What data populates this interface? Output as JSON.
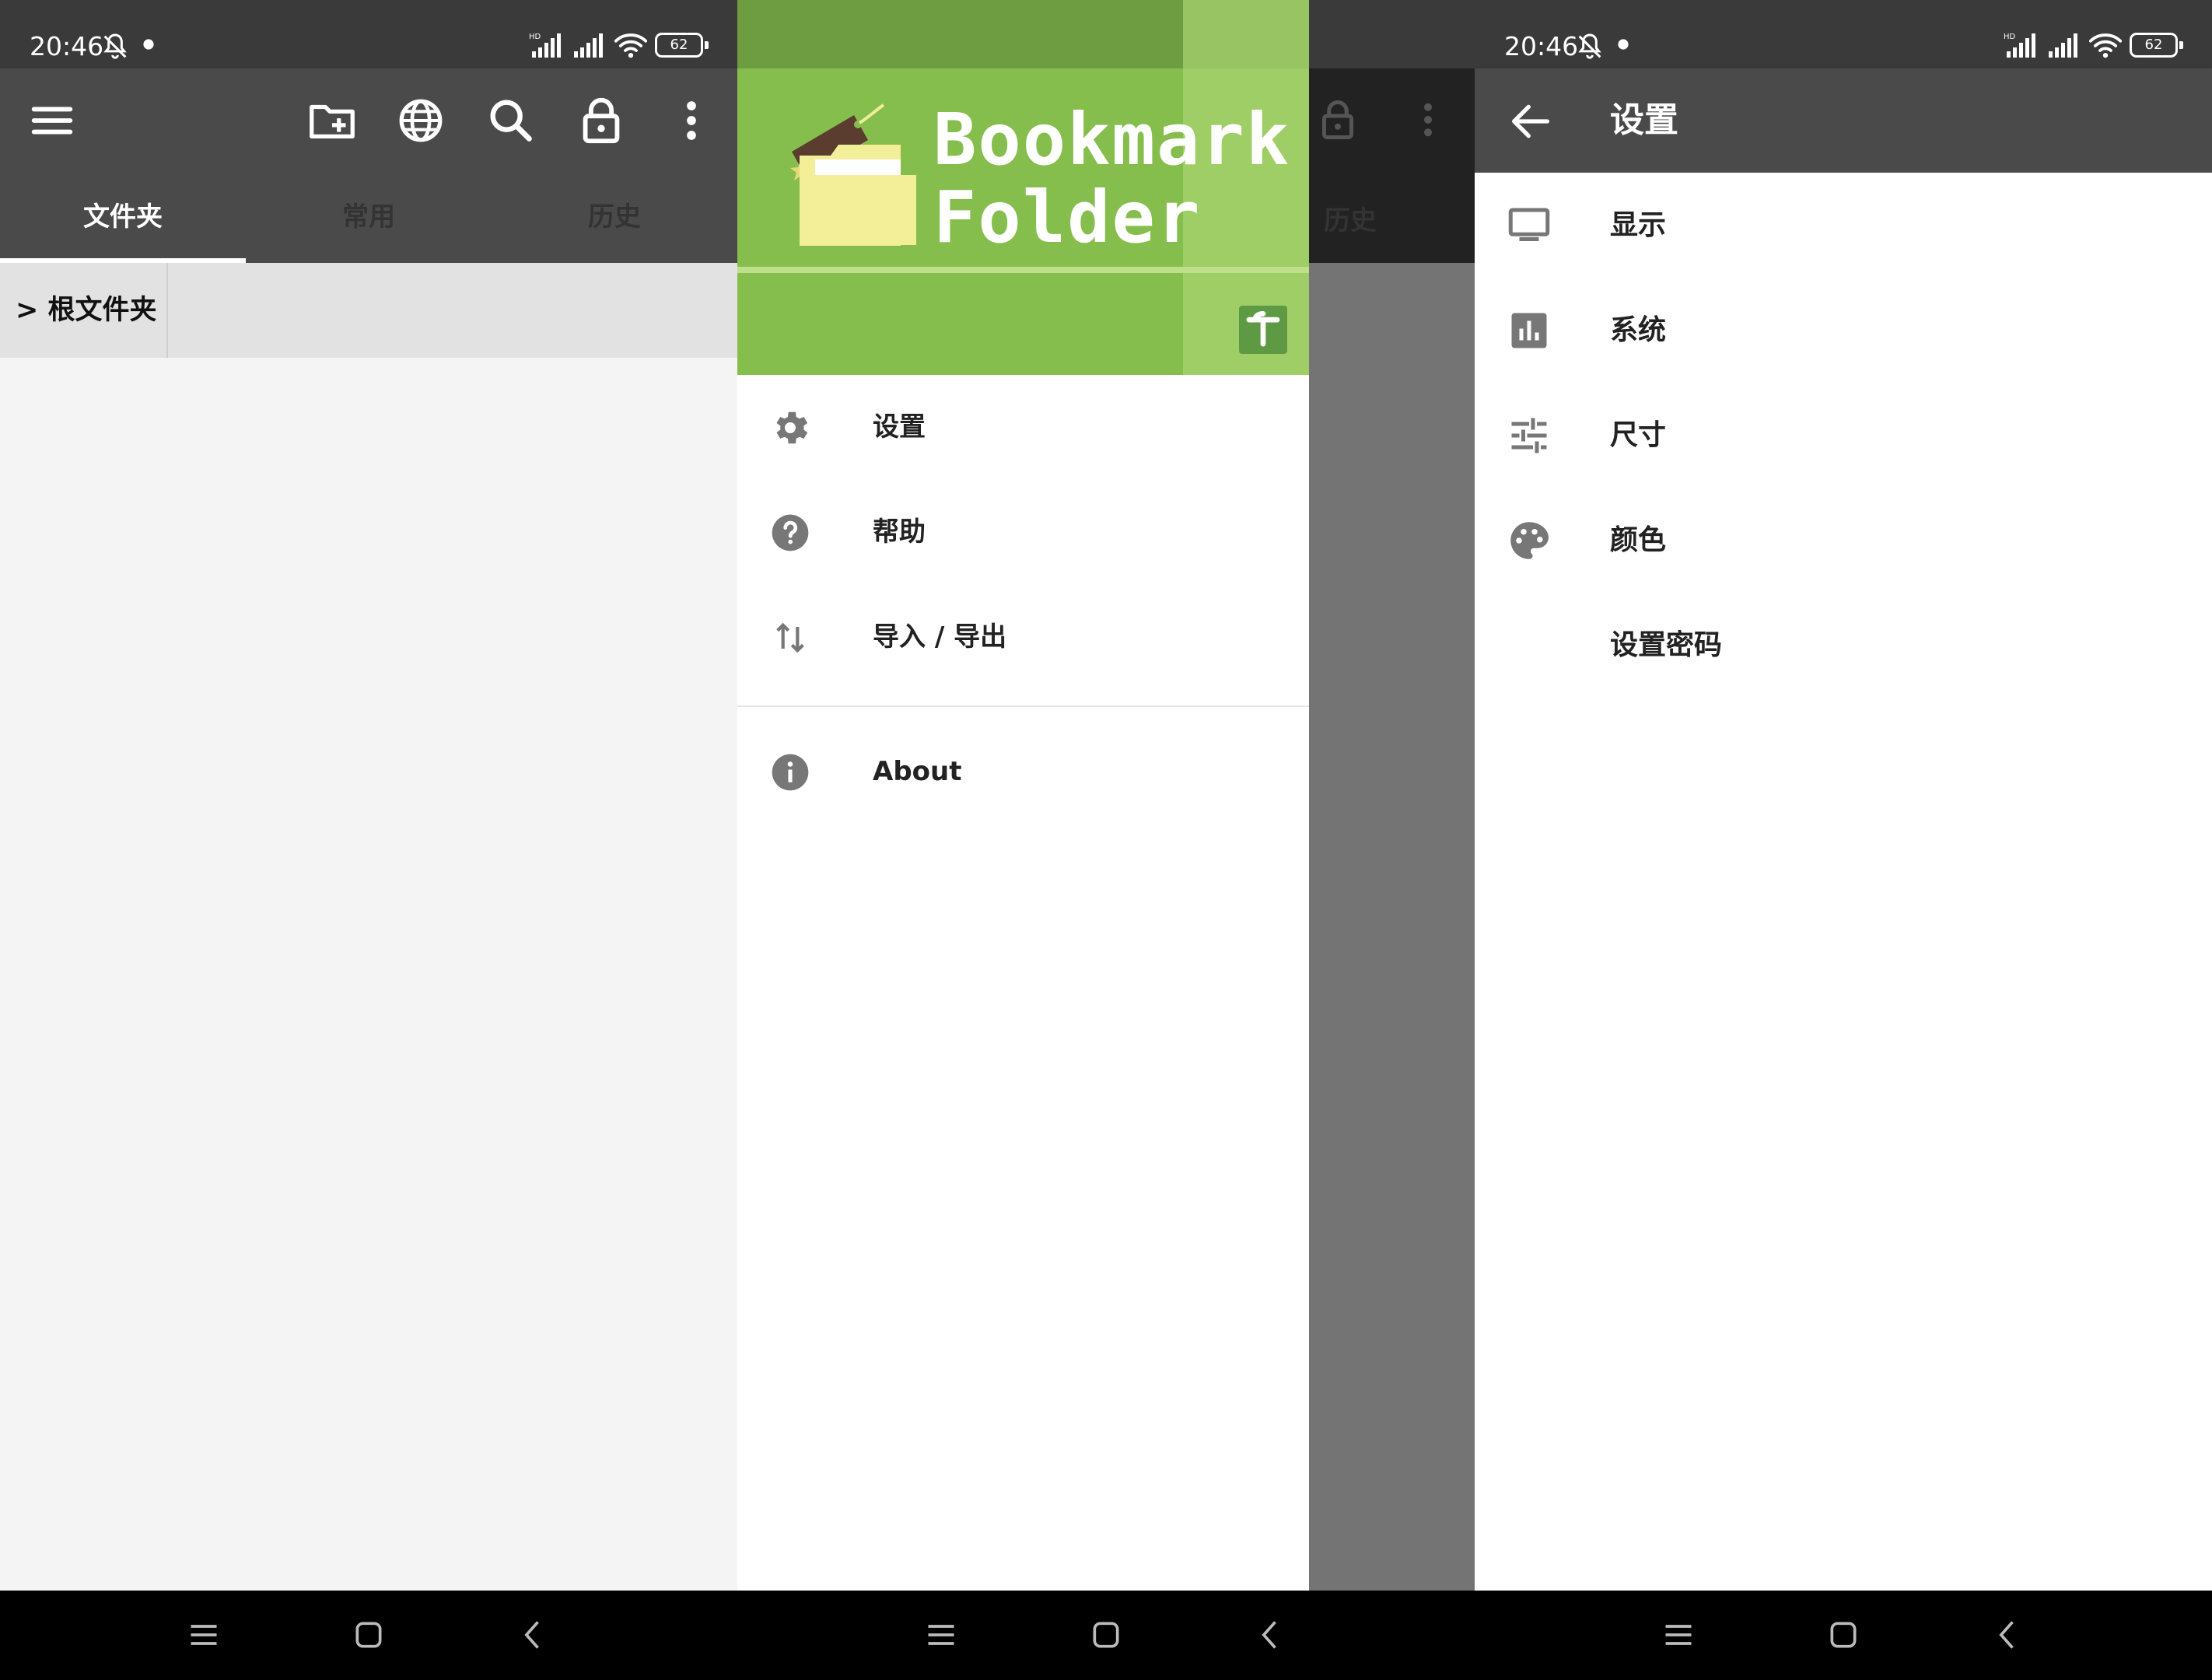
{
  "status_bar": {
    "time": "20:46",
    "battery": "62"
  },
  "screen1": {
    "tabs": [
      "文件夹",
      "常用",
      "历史"
    ],
    "breadcrumb": "> 根文件夹"
  },
  "screen2": {
    "logo_line1": "Bookmark",
    "logo_line2": "Folder",
    "menu": [
      {
        "label": "设置",
        "icon": "gear-icon"
      },
      {
        "label": "帮助",
        "icon": "help-icon"
      },
      {
        "label": "导入 / 导出",
        "icon": "import-export-icon"
      },
      {
        "label": "About",
        "icon": "info-icon"
      }
    ],
    "bg_tab": "历史"
  },
  "screen3": {
    "title": "设置",
    "items": [
      {
        "label": "显示",
        "icon": "monitor-icon"
      },
      {
        "label": "系统",
        "icon": "bar-chart-icon"
      },
      {
        "label": "尺寸",
        "icon": "sliders-icon"
      },
      {
        "label": "颜色",
        "icon": "palette-icon"
      },
      {
        "label": "设置密码",
        "icon": ""
      }
    ]
  },
  "colors": {
    "toolbar": "#4a4a4a",
    "accent_green": "#86be4e",
    "icon_grey": "#777777"
  }
}
